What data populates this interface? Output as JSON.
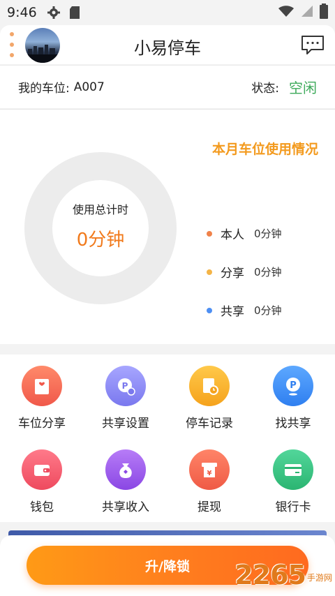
{
  "status_bar": {
    "time": "9:46"
  },
  "header": {
    "title": "小易停车"
  },
  "spot": {
    "label": "我的车位:",
    "code": "A007",
    "status_label": "状态:",
    "status_value": "空闲"
  },
  "usage": {
    "section_title": "本月车位使用情况",
    "total_label": "使用总计时",
    "total_value": "0分钟",
    "legend": [
      {
        "name": "本人",
        "value": "0分钟",
        "color": "#f0824a"
      },
      {
        "name": "分享",
        "value": "0分钟",
        "color": "#f4b447"
      },
      {
        "name": "共享",
        "value": "0分钟",
        "color": "#4d8ff3"
      }
    ]
  },
  "grid": [
    {
      "label": "车位分享",
      "icon": "parking-share-icon",
      "color": "#f46b57"
    },
    {
      "label": "共享设置",
      "icon": "share-settings-icon",
      "color": "#8b8af5"
    },
    {
      "label": "停车记录",
      "icon": "parking-record-icon",
      "color": "#f7b12a"
    },
    {
      "label": "找共享",
      "icon": "find-share-icon",
      "color": "#3f8ef3"
    },
    {
      "label": "钱包",
      "icon": "wallet-icon",
      "color": "#f2556a"
    },
    {
      "label": "共享收入",
      "icon": "share-income-icon",
      "color": "#9b57ea"
    },
    {
      "label": "提现",
      "icon": "withdraw-icon",
      "color": "#f2624a"
    },
    {
      "label": "银行卡",
      "icon": "bank-card-icon",
      "color": "#36c07e"
    }
  ],
  "bottom": {
    "button_label": "升/降锁"
  },
  "watermark": {
    "number": "2265",
    "text": "手游网"
  }
}
